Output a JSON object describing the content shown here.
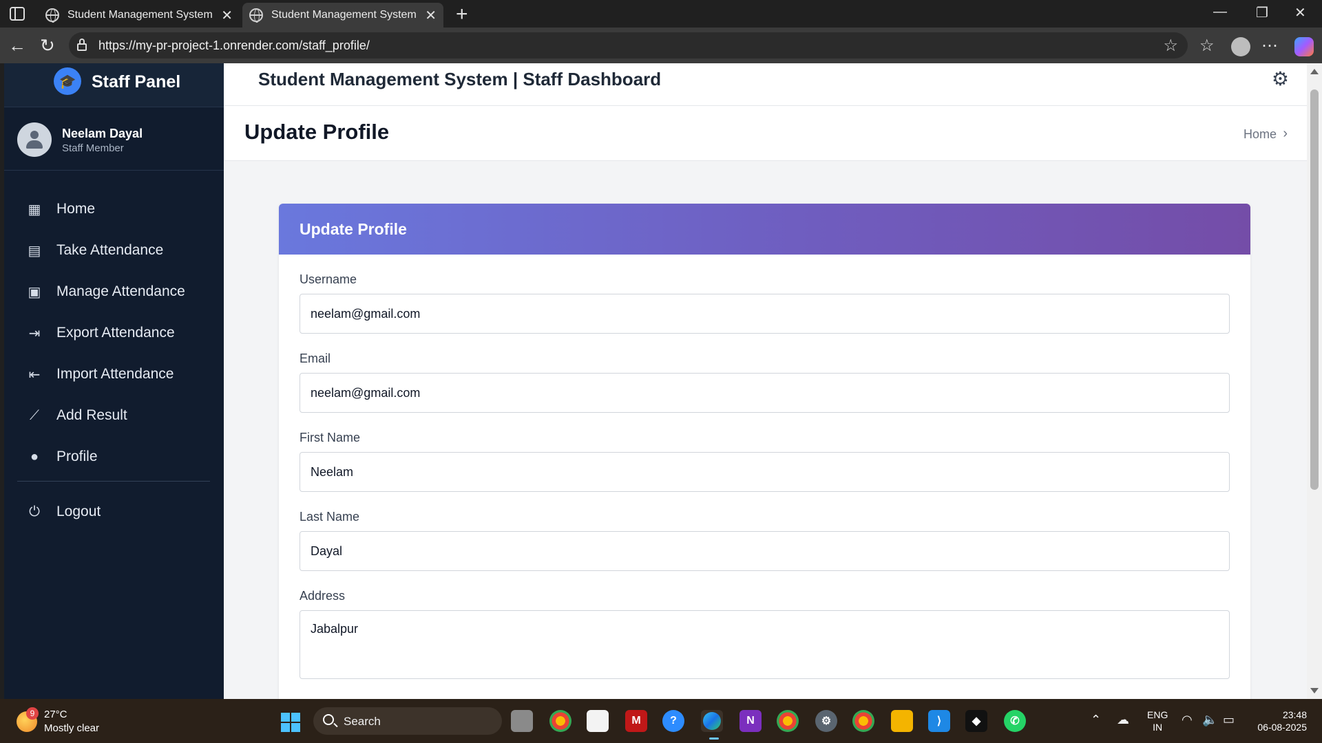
{
  "browser": {
    "tabs": [
      {
        "title": "Student Management System | Da",
        "active": false
      },
      {
        "title": "Student Management System | St",
        "active": true
      }
    ],
    "url": "https://my-pr-project-1.onrender.com/staff_profile/",
    "icons": {
      "back": "arrow-left-icon",
      "reload": "reload-icon",
      "favorite": "star-icon",
      "favorites": "favorites-icon",
      "profile": "profile-icon",
      "more": "ellipsis-icon",
      "copilot": "copilot-icon"
    }
  },
  "sidebar": {
    "brand": "Staff Panel",
    "brand_icon": "graduation-cap-icon",
    "user": {
      "name": "Neelam Dayal",
      "role": "Staff Member"
    },
    "items": [
      {
        "label": "Home",
        "icon": "grid-icon"
      },
      {
        "label": "Take Attendance",
        "icon": "calendar-icon"
      },
      {
        "label": "Manage Attendance",
        "icon": "clipboard-icon"
      },
      {
        "label": "Export Attendance",
        "icon": "file-export-icon"
      },
      {
        "label": "Import Attendance",
        "icon": "file-import-icon"
      },
      {
        "label": "Add Result",
        "icon": "chart-line-icon"
      },
      {
        "label": "Profile",
        "icon": "user-icon"
      }
    ],
    "logout": {
      "label": "Logout",
      "icon": "power-icon"
    }
  },
  "topbar": {
    "title": "Student Management System | Staff Dashboard",
    "settings_icon": "gear-icon"
  },
  "page_header": {
    "title": "Update Profile",
    "breadcrumb": "Home"
  },
  "card": {
    "title": "Update Profile",
    "fields": [
      {
        "label": "Username",
        "value": "neelam@gmail.com"
      },
      {
        "label": "Email",
        "value": "neelam@gmail.com"
      },
      {
        "label": "First Name",
        "value": "Neelam"
      },
      {
        "label": "Last Name",
        "value": "Dayal"
      },
      {
        "label": "Address",
        "value": "Jabalpur"
      }
    ]
  },
  "taskbar": {
    "weather": {
      "temp": "27°C",
      "desc": "Mostly clear",
      "badge": "9"
    },
    "search_label": "Search",
    "language": {
      "line1": "ENG",
      "line2": "IN"
    },
    "clock": {
      "time": "23:48",
      "date": "06-08-2025"
    }
  },
  "colors": {
    "sidebar_bg": "#111c2e",
    "card_header_gradient_start": "#6a78dd",
    "card_header_gradient_end": "#744da8",
    "accent": "#3b82f6"
  }
}
